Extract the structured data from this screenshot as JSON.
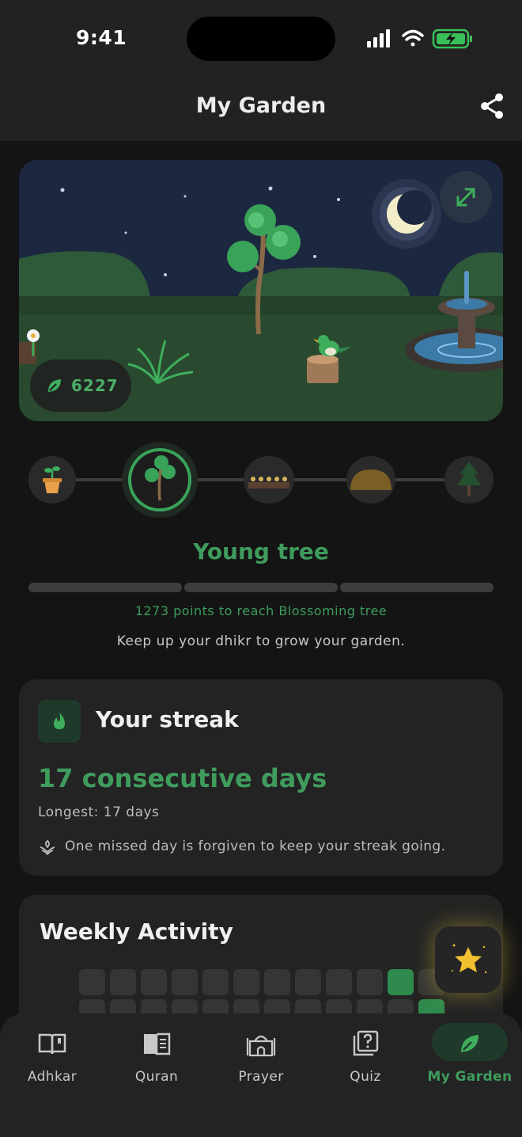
{
  "status_bar": {
    "time": "9:41"
  },
  "header": {
    "title": "My Garden",
    "share_icon": "share-icon"
  },
  "garden": {
    "points": "6227",
    "expand_icon": "expand-icon",
    "leaf_icon": "leaf-icon"
  },
  "stages": {
    "items": [
      {
        "name": "Seedling",
        "icon": "potted-sprout-icon"
      },
      {
        "name": "Young tree",
        "icon": "young-tree-icon",
        "active": true
      },
      {
        "name": "Flower bed",
        "icon": "flower-bed-icon"
      },
      {
        "name": "Bush",
        "icon": "bush-icon"
      },
      {
        "name": "Pine tree",
        "icon": "pine-tree-icon"
      }
    ],
    "current_title": "Young tree",
    "progress_fraction": 0.0,
    "points_to_next": "1273 points to reach Blossoming tree",
    "encouragement": "Keep up your dhikr to grow your garden."
  },
  "streak": {
    "title": "Your streak",
    "days": "17 consecutive days",
    "longest": "Longest: 17 days",
    "note": "One missed day is forgiven to keep your streak going.",
    "icon": "flame-icon"
  },
  "weekly": {
    "title": "Weekly Activity",
    "row1": [
      0,
      0,
      0,
      0,
      0,
      0,
      0,
      0,
      0,
      0,
      1,
      0
    ],
    "row2": [
      0,
      0,
      0,
      0,
      0,
      0,
      0,
      0,
      0,
      0,
      0,
      1
    ]
  },
  "fab": {
    "icon": "star-icon"
  },
  "tabs": [
    {
      "label": "Adhkar",
      "icon": "book-open-icon"
    },
    {
      "label": "Quran",
      "icon": "quran-icon"
    },
    {
      "label": "Prayer",
      "icon": "mosque-icon"
    },
    {
      "label": "Quiz",
      "icon": "quiz-icon"
    },
    {
      "label": "My Garden",
      "icon": "leaf-icon",
      "active": true
    }
  ],
  "colors": {
    "accent": "#3f9c5d",
    "background": "#141414",
    "card": "#232323"
  }
}
